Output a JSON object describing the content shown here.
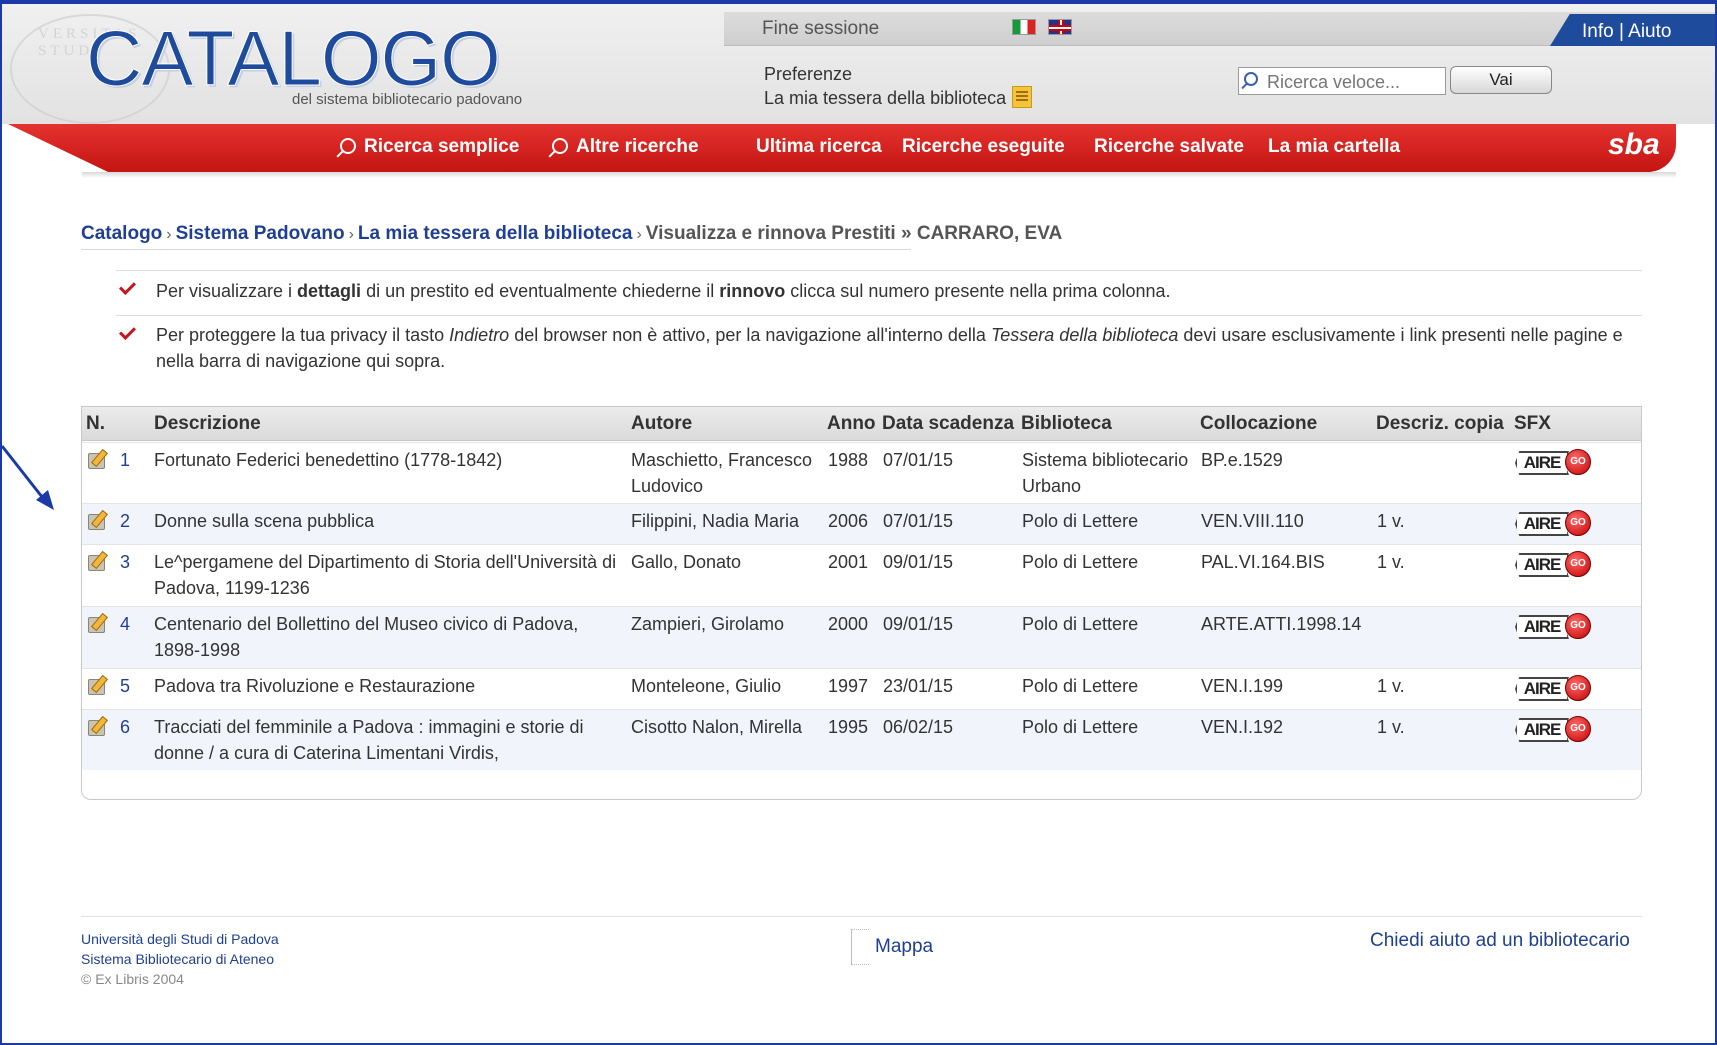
{
  "header": {
    "logo_text": "CATALOGO",
    "logo_subtitle": "del sistema bibliotecario padovano",
    "seal_text": "VERSITAS STUD",
    "fine_sessione": "Fine sessione",
    "info_label": "Info",
    "info_sep": " | ",
    "aiuto_label": "Aiuto",
    "preferenze": "Preferenze",
    "tessera": "La mia tessera della biblioteca",
    "search_placeholder": "Ricerca veloce...",
    "vai_label": "Vai"
  },
  "nav": {
    "items": [
      "Ricerca semplice",
      "Altre ricerche",
      "Ultima ricerca",
      "Ricerche eseguite",
      "Ricerche salvate",
      "La mia cartella"
    ],
    "sba_logo": "sba"
  },
  "breadcrumb": {
    "items": [
      "Catalogo",
      "Sistema Padovano",
      "La mia tessera della biblioteca"
    ],
    "sep": "›",
    "current": "Visualizza e rinnova Prestiti",
    "user_sep": "»",
    "user": "CARRARO, EVA"
  },
  "notes": {
    "n1_a": "Per visualizzare i ",
    "n1_b": "dettagli",
    "n1_c": " di un prestito ed eventualmente chiederne il ",
    "n1_d": "rinnovo",
    "n1_e": " clicca sul numero presente nella prima colonna.",
    "n2_a": "Per proteggere la tua privacy il tasto ",
    "n2_b": "Indietro",
    "n2_c": " del browser non è attivo, per la navigazione all'interno della ",
    "n2_d": "Tessera della biblioteca",
    "n2_e": " devi usare esclusivamente i link presenti nelle pagine e nella barra di navigazione qui sopra."
  },
  "table": {
    "headers": [
      "N.",
      "Descrizione",
      "Autore",
      "Anno",
      "Data scadenza",
      "Biblioteca",
      "Collocazione",
      "Descriz. copia",
      "SFX"
    ],
    "rows": [
      {
        "n": "1",
        "descrizione": "Fortunato Federici benedettino (1778-1842)",
        "autore": "Maschietto, Francesco Ludovico",
        "anno": "1988",
        "scadenza": "07/01/15",
        "biblioteca": "Sistema bibliotecario Urbano",
        "collocazione": "BP.e.1529",
        "copia": ""
      },
      {
        "n": "2",
        "descrizione": "Donne sulla scena pubblica",
        "autore": "Filippini, Nadia Maria",
        "anno": "2006",
        "scadenza": "07/01/15",
        "biblioteca": "Polo di Lettere",
        "collocazione": "VEN.VIII.110",
        "copia": "1 v."
      },
      {
        "n": "3",
        "descrizione": "Le^pergamene del Dipartimento di Storia dell'Università di Padova, 1199-1236",
        "autore": "Gallo, Donato",
        "anno": "2001",
        "scadenza": "09/01/15",
        "biblioteca": "Polo di Lettere",
        "collocazione": "PAL.VI.164.BIS",
        "copia": "1 v."
      },
      {
        "n": "4",
        "descrizione": "Centenario del Bollettino del Museo civico di Padova, 1898-1998",
        "autore": "Zampieri, Girolamo",
        "anno": "2000",
        "scadenza": "09/01/15",
        "biblioteca": "Polo di Lettere",
        "collocazione": "ARTE.ATTI.1998.14",
        "copia": ""
      },
      {
        "n": "5",
        "descrizione": "Padova tra Rivoluzione e Restaurazione",
        "autore": "Monteleone, Giulio",
        "anno": "1997",
        "scadenza": "23/01/15",
        "biblioteca": "Polo di Lettere",
        "collocazione": "VEN.I.199",
        "copia": "1 v."
      },
      {
        "n": "6",
        "descrizione": "Tracciati del femminile a Padova : immagini e storie di donne / a cura di Caterina Limentani Virdis,",
        "autore": "Cisotto Nalon, Mirella",
        "anno": "1995",
        "scadenza": "06/02/15",
        "biblioteca": "Polo di Lettere",
        "collocazione": "VEN.I.192",
        "copia": "1 v."
      }
    ],
    "sfx_label": "AIRE",
    "sfx_go": "GO"
  },
  "footer": {
    "line1": "Università degli Studi di Padova",
    "line2": "Sistema Bibliotecario di Ateneo",
    "copyright": "© Ex Libris 2004",
    "mappa": "Mappa",
    "chiedi": "Chiedi aiuto ad un bibliotecario"
  },
  "colors": {
    "brand_blue": "#1f4b9c",
    "nav_red": "#d4201d",
    "link_blue": "#1f3f95",
    "check_red": "#c4161c",
    "annotation_arrow": "#1a3aa8"
  }
}
